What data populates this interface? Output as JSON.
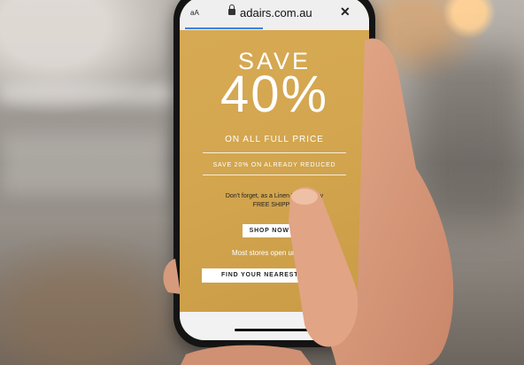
{
  "browser": {
    "text_size_label": "aA",
    "url": "adairs.com.au",
    "close_label": "✕"
  },
  "promo": {
    "save": "SAVE",
    "percent": "40%",
    "scope": "ON ALL FULL PRICE",
    "secondary": "SAVE 20% ON ALREADY REDUCED",
    "note_line1": "Don't forget, as a Linen Lover          enjoy",
    "note_line2": "FREE SHIPPIN",
    "shop_button": "SHOP NOW >",
    "stores_text": "Most stores open until 9pm",
    "find_button": "FIND YOUR NEAREST STORE"
  },
  "colors": {
    "banner": "#d3a64f",
    "browser_progress": "#3b83e0",
    "text_light": "#ffffff"
  }
}
